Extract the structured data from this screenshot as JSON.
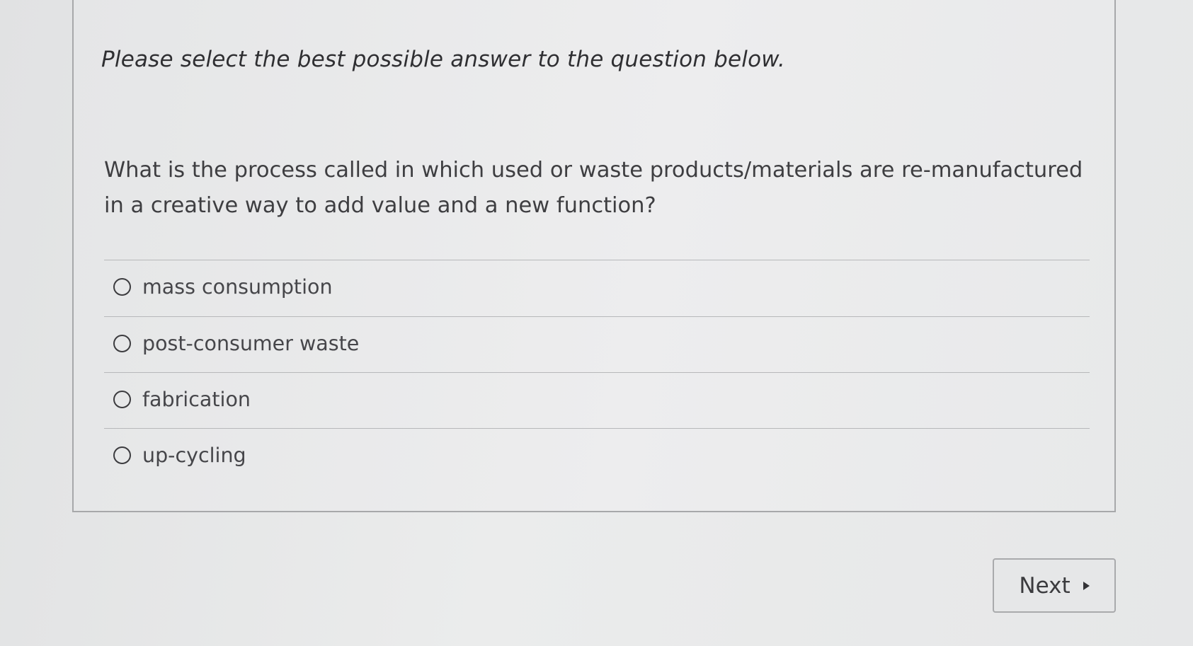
{
  "quiz": {
    "instruction": "Please select the best possible answer to the question below.",
    "question": "What is the process called in which used or waste products/materials are re-manufactured in a creative way to add value and a new function?",
    "options": [
      {
        "label": "mass consumption",
        "selected": false
      },
      {
        "label": "post-consumer waste",
        "selected": false
      },
      {
        "label": "fabrication",
        "selected": false
      },
      {
        "label": "up-cycling",
        "selected": false
      }
    ]
  },
  "navigation": {
    "next_label": "Next",
    "next_icon": "triangle-right-icon"
  }
}
